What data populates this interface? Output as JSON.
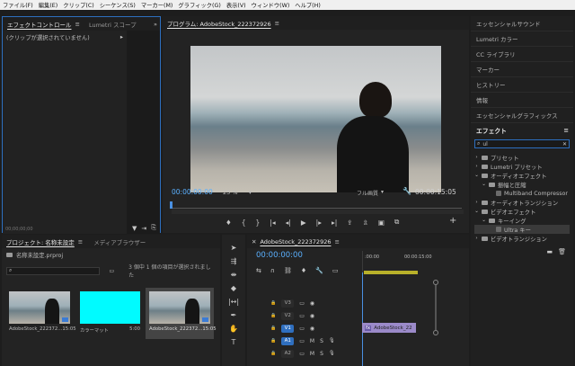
{
  "menu": [
    "ファイル(F)",
    "編集(E)",
    "クリップ(C)",
    "シーケンス(S)",
    "マーカー(M)",
    "グラフィック(G)",
    "表示(V)",
    "ウィンドウ(W)",
    "ヘルプ(H)"
  ],
  "effect_controls": {
    "tab1": "エフェクトコントロール",
    "tab2": "Lumetri スコープ",
    "no_clip": "(クリップが選択されていません)",
    "timecode": "00;00;00;00"
  },
  "program": {
    "title": "プログラム: AdobeStock_222372926",
    "timecode": "00:00:00:00",
    "zoom": "25 %",
    "quality": "フル画質",
    "duration": "00:00:15:05"
  },
  "right_panels": [
    "エッセンシャルサウンド",
    "Lumetri カラー",
    "CC ライブラリ",
    "マーカー",
    "ヒストリー",
    "情報",
    "エッセンシャルグラフィックス"
  ],
  "effects": {
    "title": "エフェクト",
    "search": "ul",
    "items": [
      {
        "label": "プリセット",
        "indent": 0,
        "open": false
      },
      {
        "label": "Lumetri プリセット",
        "indent": 0,
        "open": false
      },
      {
        "label": "オーディオエフェクト",
        "indent": 0,
        "open": true
      },
      {
        "label": "振幅と圧縮",
        "indent": 1,
        "open": true
      },
      {
        "label": "Multiband Compressor",
        "indent": 2,
        "leaf": true
      },
      {
        "label": "オーディオトランジション",
        "indent": 0,
        "open": false
      },
      {
        "label": "ビデオエフェクト",
        "indent": 0,
        "open": true
      },
      {
        "label": "キーイング",
        "indent": 1,
        "open": true
      },
      {
        "label": "Ultra キー",
        "indent": 2,
        "leaf": true,
        "selected": true
      },
      {
        "label": "ビデオトランジション",
        "indent": 0,
        "open": false
      }
    ]
  },
  "project": {
    "tab1": "プロジェクト: 名称未設定",
    "tab2": "メディアブラウザー",
    "file": "名称未設定.prproj",
    "count": "3 個中 1 個の項目が選択されました",
    "items": [
      {
        "name": "AdobeStock_222372...",
        "dur": "15:05"
      },
      {
        "name": "カラーマット",
        "dur": "5:00"
      },
      {
        "name": "AdobeStock_222372...",
        "dur": "15:05"
      }
    ]
  },
  "timeline": {
    "title": "AdobeStock_222372926",
    "timecode": "00:00:00:00",
    "ruler_start": ":00:00",
    "ruler_end": "00:00:15:00",
    "clip": "AdobeStock_22",
    "tracks": [
      {
        "name": "V3",
        "kind": "v"
      },
      {
        "name": "V2",
        "kind": "v"
      },
      {
        "name": "V1",
        "kind": "v",
        "active": true
      },
      {
        "name": "A1",
        "kind": "a",
        "active": true
      },
      {
        "name": "A2",
        "kind": "a"
      }
    ]
  }
}
